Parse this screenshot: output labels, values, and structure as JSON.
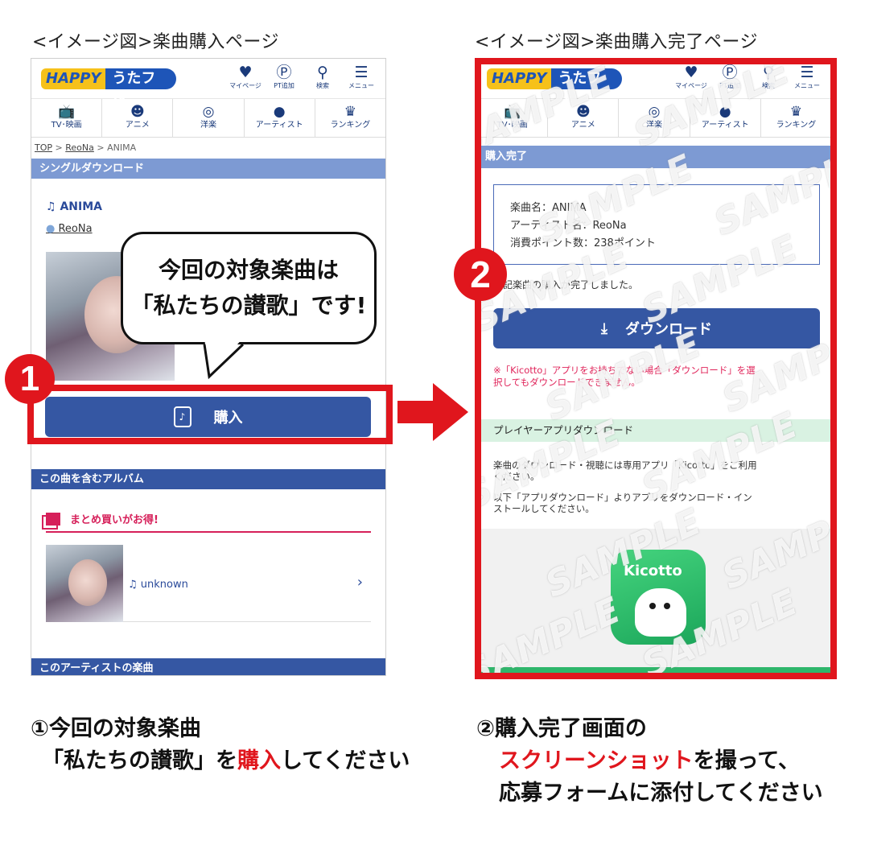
{
  "captions": {
    "left": "<イメージ図>楽曲購入ページ",
    "right": "<イメージ図>楽曲購入完了ページ"
  },
  "header": {
    "logo_left": "HAPPY",
    "logo_right": "うたフル",
    "icons": [
      {
        "name": "heart-icon",
        "glyph": "♥",
        "label": "マイページ"
      },
      {
        "name": "points-icon",
        "glyph": "Ⓟ",
        "label": "PT追加"
      },
      {
        "name": "search-icon",
        "glyph": "⚲",
        "label": "検索"
      },
      {
        "name": "menu-icon",
        "glyph": "☰",
        "label": "メニュー"
      }
    ]
  },
  "nav": [
    {
      "name": "tv-icon",
      "glyph": "📺",
      "label": "TV･映画"
    },
    {
      "name": "smile-icon",
      "glyph": "☻",
      "label": "アニメ"
    },
    {
      "name": "disc-icon",
      "glyph": "◎",
      "label": "洋楽"
    },
    {
      "name": "person-icon",
      "glyph": "●",
      "label": "アーティスト"
    },
    {
      "name": "crown-icon",
      "glyph": "♛",
      "label": "ランキング"
    }
  ],
  "left_page": {
    "breadcrumb": {
      "top": "TOP",
      "sep1": " > ",
      "artist": "ReoNa",
      "sep2": " > ",
      "song": "ANIMA"
    },
    "section_single": "シングルダウンロード",
    "song_title": "ANIMA",
    "artist_name": "ReoNa",
    "bubble_line1": "今回の対象楽曲は",
    "bubble_line2": "「私たちの讃歌」です!",
    "buy_label": "購入",
    "section_album": "この曲を含むアルバム",
    "matome_label": "まとめ買いがお得!",
    "album_label": "unknown",
    "section_artist": "このアーティストの楽曲"
  },
  "right_page": {
    "section_title": "購入完了",
    "info_song": "楽曲名：ANIMA",
    "info_artist": "アーティスト名：ReoNa",
    "info_points": "消費ポイント数：238ポイント",
    "complete_text": "上記楽曲の購入が完了しました。",
    "download_label": "ダウンロード",
    "note_line1": "※「Kicotto」アプリをお持ちでない場合「ダウンロード」を選",
    "note_line2": "択してもダウンロードできません。",
    "player_title": "プレイヤーアプリダウンロード",
    "para1_line1": "楽曲のダウンロード・視聴には専用アプリ「Kicotto」をご利用",
    "para1_line2": "ください。",
    "para2_line1": "以下「アプリダウンロード」よりアプリをダウンロード・イン",
    "para2_line2": "ストールしてください。",
    "app_name": "Kicotto",
    "watermark": "SAMPLE"
  },
  "badges": {
    "one": "1",
    "two": "2"
  },
  "bottom": {
    "left_line1": "①今回の対象楽曲",
    "left_line2_a": "「私たちの讃歌」を",
    "left_line2_hl": "購入",
    "left_line2_b": "してください",
    "right_line1": "②購入完了画面の",
    "right_line2_hl": "スクリーンショット",
    "right_line2_b": "を撮って、",
    "right_line3": "応募フォームに添付してください"
  },
  "colors": {
    "brand_blue": "#3557a3",
    "section_light": "#7d9ad3",
    "alert_red": "#e0161d",
    "pink": "#d6205a"
  }
}
